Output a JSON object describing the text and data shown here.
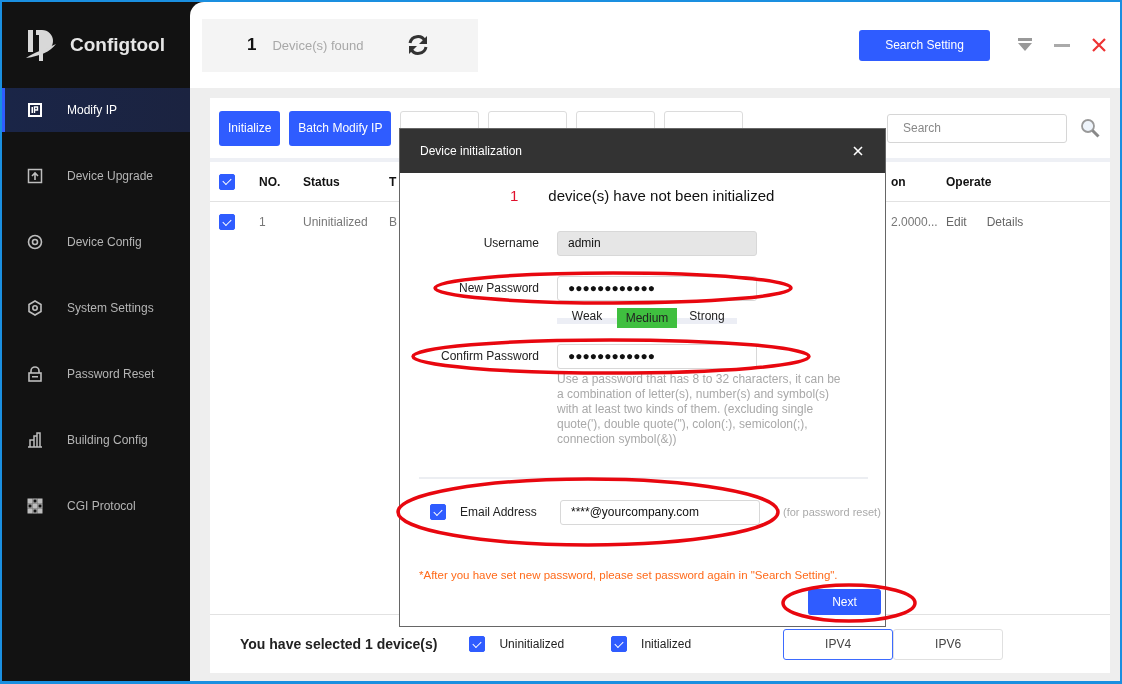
{
  "app": {
    "name": "Configtool"
  },
  "sidebar": {
    "items": [
      {
        "label": "Modify IP",
        "selected": true
      },
      {
        "label": "Device Upgrade",
        "selected": false
      },
      {
        "label": "Device Config",
        "selected": false
      },
      {
        "label": "System Settings",
        "selected": false
      },
      {
        "label": "Password Reset",
        "selected": false
      },
      {
        "label": "Building Config",
        "selected": false
      },
      {
        "label": "CGI Protocol",
        "selected": false
      }
    ]
  },
  "header": {
    "count": "1",
    "count_label": "Device(s) found",
    "search_setting": "Search Setting"
  },
  "toolbar": [
    {
      "kind": "primary",
      "label": "Initialize"
    },
    {
      "kind": "primary",
      "label": "Batch Modify IP"
    },
    {
      "kind": "outline"
    },
    {
      "kind": "outline"
    },
    {
      "kind": "outline"
    },
    {
      "kind": "outline"
    }
  ],
  "search": {
    "placeholder": "Search"
  },
  "table": {
    "all_checked": true,
    "columns": [
      "NO.",
      "Status",
      "T",
      "on",
      "Operate"
    ],
    "rows": [
      {
        "checked": true,
        "cells": [
          "1",
          "Uninitialized",
          "B",
          "2.0000..."
        ],
        "actions": [
          "Edit",
          "Details"
        ]
      }
    ]
  },
  "footer": {
    "selected_text": "You have selected 1  device(s)",
    "filters": [
      {
        "label": "Uninitialized",
        "checked": true
      },
      {
        "label": "Initialized",
        "checked": true
      }
    ],
    "tabs": [
      {
        "label": "IPV4",
        "selected": true
      },
      {
        "label": "IPV6",
        "selected": false
      }
    ]
  },
  "dialog": {
    "title": "Device initialization",
    "count": "1",
    "message": "device(s) have not been initialized",
    "username": {
      "label": "Username",
      "value": "admin"
    },
    "new_password": {
      "label": "New Password",
      "value": "●●●●●●●●●●●●",
      "highlighted": true
    },
    "strength": [
      {
        "label": "Weak",
        "selected": false
      },
      {
        "label": "Medium",
        "selected": true
      },
      {
        "label": "Strong",
        "selected": false
      }
    ],
    "confirm_password": {
      "label": "Confirm Password",
      "value": "●●●●●●●●●●●●",
      "highlighted": true
    },
    "hint": "Use a password that has 8 to 32 characters, it can be a combination of letter(s), number(s) and symbol(s) with at least two kinds of them. (excluding single quote('), double quote(\"), colon(:), semicolon(;), connection symbol(&))",
    "email": {
      "label": "Email Address",
      "checked": true,
      "value": "****@yourcompany.com",
      "note": "(for password reset)",
      "highlighted": true
    },
    "warning": "*After you have set new password, please set password again in \"Search Setting\".",
    "next": {
      "label": "Next",
      "highlighted": true
    }
  }
}
